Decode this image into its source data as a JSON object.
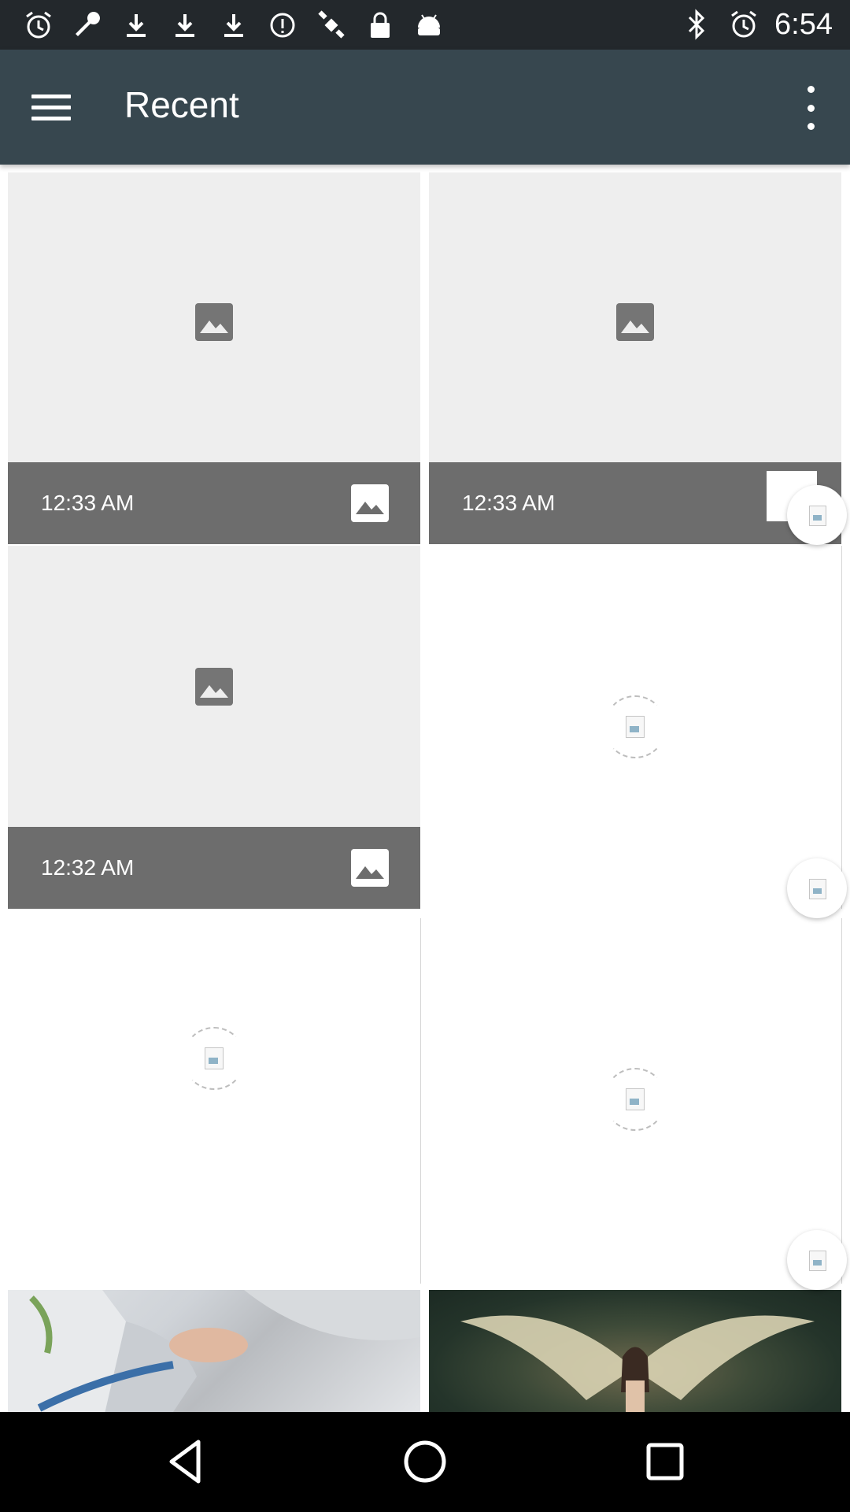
{
  "status_bar": {
    "time": "6:54",
    "left_icons": [
      "alarm-icon",
      "wrench-icon",
      "download-icon",
      "download-icon",
      "download-icon",
      "info-icon",
      "satellite-icon",
      "lock-icon",
      "android-icon"
    ],
    "right_icons": [
      "bluetooth-icon",
      "alarm-icon"
    ]
  },
  "toolbar": {
    "title": "Recent",
    "background": "#37474f"
  },
  "tiles": [
    {
      "time": "12:33 AM"
    },
    {
      "time": "12:33 AM"
    },
    {
      "time": "12:32 AM"
    }
  ],
  "colors": {
    "status_bar": "#23282c",
    "caption_bg": "#6d6d6d",
    "placeholder_bg": "#eeeeee"
  }
}
